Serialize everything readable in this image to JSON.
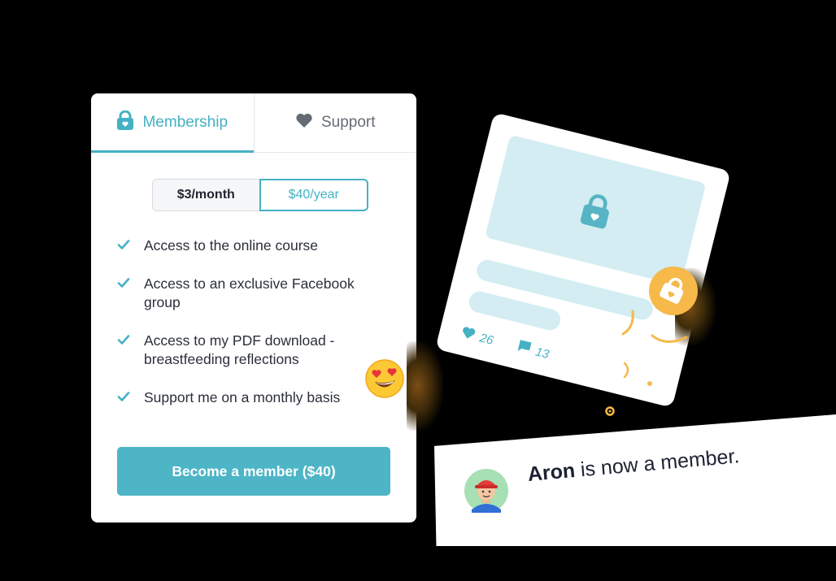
{
  "membership_card": {
    "tabs": [
      {
        "label": "Membership",
        "icon": "lock-icon",
        "active": true
      },
      {
        "label": "Support",
        "icon": "heart-icon",
        "active": false
      }
    ],
    "pricing_toggle": {
      "monthly_label": "$3/month",
      "yearly_label": "$40/year",
      "selected": "yearly"
    },
    "features": [
      "Access to the online course",
      "Access to an exclusive Facebook group",
      "Access to my PDF download - breastfeeding reflections",
      "Support me on a monthly basis"
    ],
    "cta_label": "Become a member ($40)"
  },
  "post_card": {
    "likes": "26",
    "comments": "13"
  },
  "notification": {
    "name": "Aron",
    "message": "is now a member."
  },
  "colors": {
    "accent": "#45b1c2",
    "button": "#4db5c6",
    "badge": "#f6b94a",
    "placeholder": "#d3edf2"
  }
}
